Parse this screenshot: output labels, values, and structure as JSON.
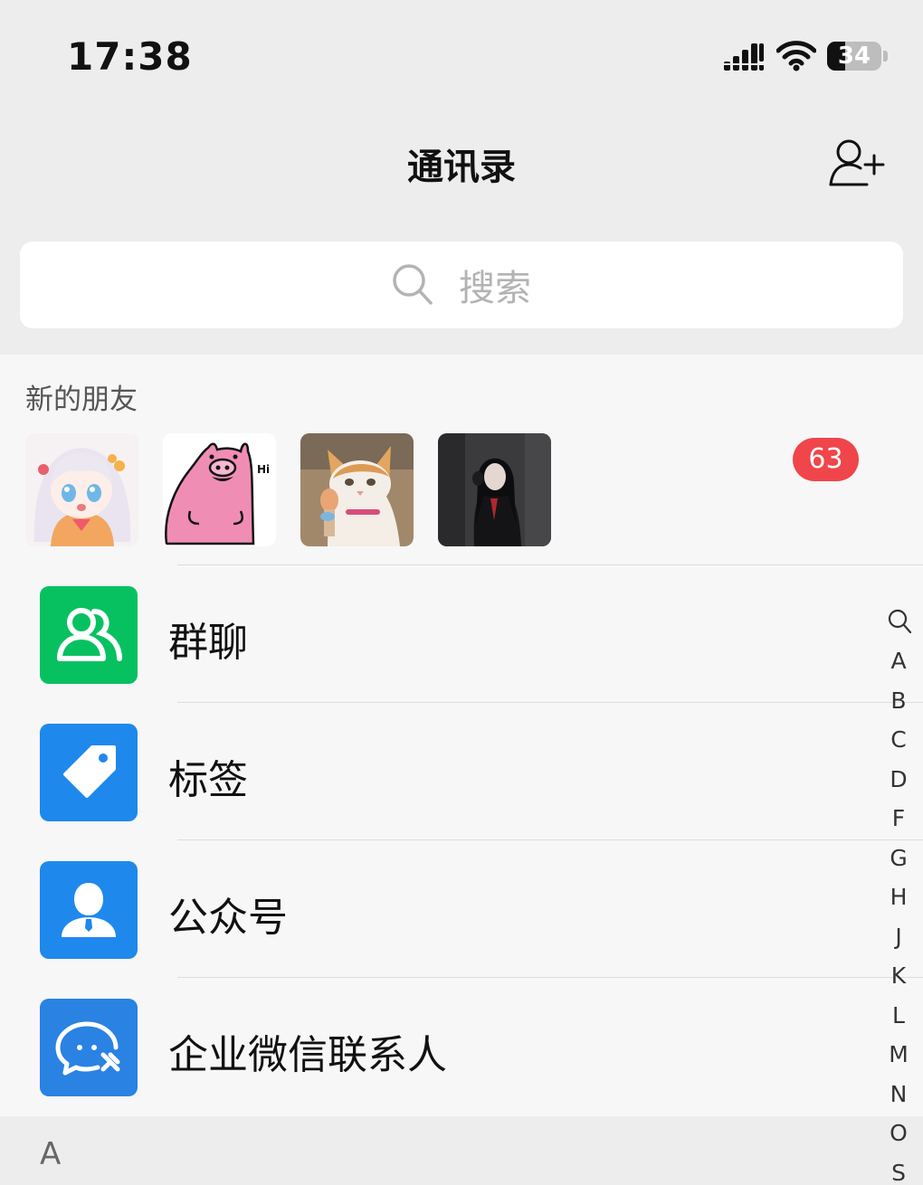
{
  "status_bar": {
    "time": "17:38",
    "battery": "34",
    "battery_level": 0.34,
    "icons": [
      "cellular-signal-icon",
      "wifi-icon",
      "battery-icon"
    ]
  },
  "header": {
    "title": "通讯录",
    "add_icon": "add-friend-icon"
  },
  "search": {
    "placeholder": "搜索",
    "icon": "search-icon"
  },
  "new_friends": {
    "label": "新的朋友",
    "badge": "63",
    "avatars": [
      "anime-girl-avatar",
      "pink-pig-hi-avatar",
      "cat-avatar",
      "dark-girl-avatar"
    ]
  },
  "menu": [
    {
      "label": "群聊",
      "icon": "group-chat-icon",
      "color": "#07c160"
    },
    {
      "label": "标签",
      "icon": "tag-icon",
      "color": "#1f88ec"
    },
    {
      "label": "公众号",
      "icon": "official-account-icon",
      "color": "#1f88ec"
    },
    {
      "label": "企业微信联系人",
      "icon": "wecom-icon",
      "color": "#2a82e2"
    }
  ],
  "section": {
    "letter": "A"
  },
  "index": [
    "A",
    "B",
    "C",
    "D",
    "F",
    "G",
    "H",
    "J",
    "K",
    "L",
    "M",
    "N",
    "O",
    "S"
  ],
  "colors": {
    "badge": "#f0454a",
    "background": "#ededed"
  }
}
